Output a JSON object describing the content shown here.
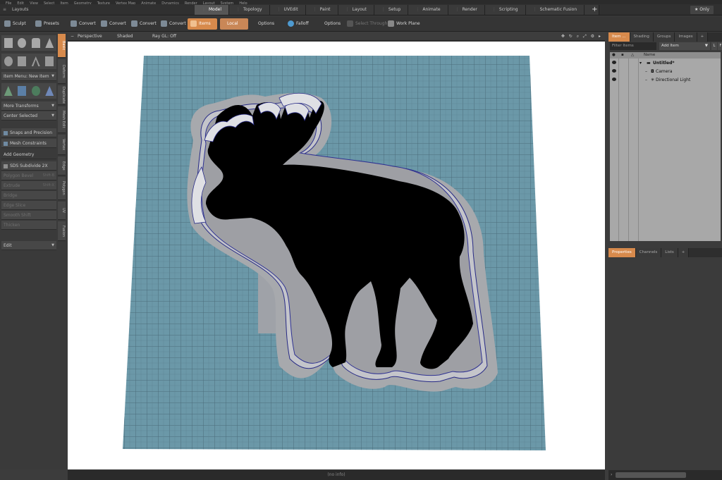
{
  "menubar": [
    "File",
    "Edit",
    "View",
    "Select",
    "Item",
    "Geometry",
    "Texture",
    "Vertex Map",
    "Animate",
    "Dynamics",
    "Render",
    "Layout",
    "System",
    "Help"
  ],
  "layouts_label": "Layouts",
  "layout_tabs": [
    "Model",
    "Topology",
    "UVEdit",
    "Paint",
    "Layout",
    "Setup",
    "Animate",
    "Render",
    "Scripting",
    "Schematic Fusion"
  ],
  "only_label": "Only",
  "toolbar": {
    "sculpt": "Sculpt",
    "presets": "Presets",
    "convert1": "Convert",
    "convert2": "Convert",
    "convert3": "Convert",
    "convert4": "Convert",
    "items": "Items",
    "local": "Local",
    "options1": "Options",
    "falloff": "Falloff",
    "options2": "Options",
    "select_through": "Select Through",
    "work_plane": "Work Plane"
  },
  "viewport": {
    "view": "Perspective",
    "shading": "Shaded",
    "raygl": "Ray GL: Off"
  },
  "left_tabs": [
    "Basic",
    "Deform",
    "Duplicate",
    "Mesh Edit",
    "Vertex",
    "Edge",
    "Polygon",
    "UV",
    "Fusion"
  ],
  "left": {
    "item_menu": "Item Menu: New Item",
    "more_transforms": "More Transforms",
    "center_selected": "Center Selected",
    "snaps": "Snaps and Precision",
    "mesh_constraints": "Mesh Constraints",
    "add_geometry": "Add Geometry",
    "sds": "SDS Subdivide 2X",
    "polygon_bevel": "Polygon Bevel",
    "polygon_bevel_sc": "Shift-B",
    "extrude": "Extrude",
    "extrude_sc": "Shift-X",
    "bridge": "Bridge",
    "edge_slice": "Edge Slice",
    "smooth_shift": "Smooth Shift",
    "thicken": "Thicken",
    "edit": "Edit"
  },
  "right": {
    "tabs": [
      "Item ...",
      "Shading",
      "Groups",
      "Images",
      "+"
    ],
    "filter_placeholder": "Filter Items",
    "add_item": "Add Item",
    "box_l": "L",
    "box_f": "F",
    "name_header": "Name",
    "tree": [
      "Untitled*",
      "Camera",
      "Directional Light"
    ],
    "prop_tabs": [
      "Properties",
      "Channels",
      "Lists",
      "+"
    ]
  },
  "status": "(no info)"
}
